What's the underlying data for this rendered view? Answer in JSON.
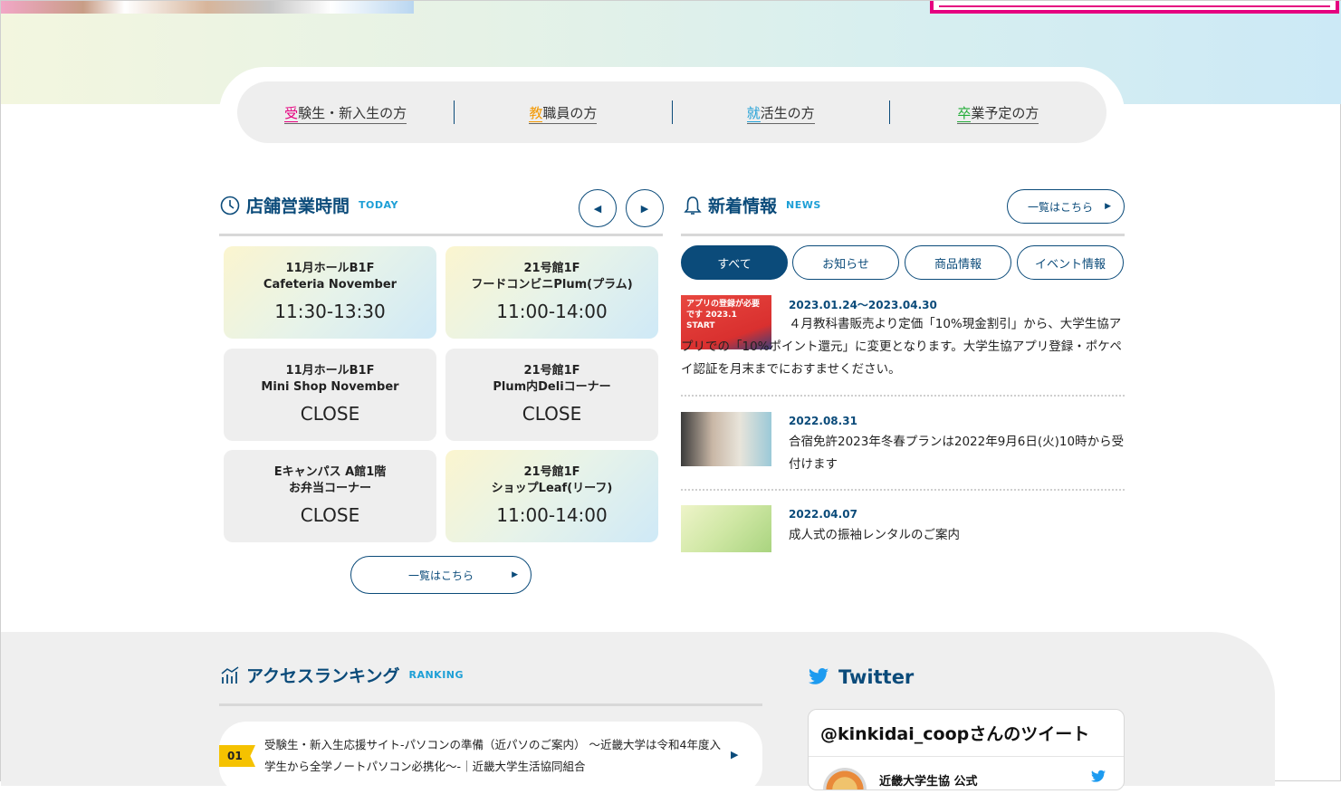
{
  "nav": {
    "items": [
      {
        "first": "受",
        "rest": "験生・新入生の方",
        "color": "#e5007f"
      },
      {
        "first": "教",
        "rest": "職員の方",
        "color": "#f39800"
      },
      {
        "first": "就",
        "rest": "活生の方",
        "color": "#1d9fd6"
      },
      {
        "first": "卒",
        "rest": "業予定の方",
        "color": "#22ac38"
      }
    ]
  },
  "hours": {
    "title": "店舗営業時間",
    "subtitle": "TODAY",
    "prev_label": "◀",
    "next_label": "▶",
    "stores": [
      {
        "line1": "11月ホールB1F",
        "line2": "Cafeteria November",
        "hours": "11:30-13:30"
      },
      {
        "line1": "21号館1F",
        "line2": "フードコンビニPlum(プラム)",
        "hours": "11:00-14:00"
      },
      {
        "line1": "11月ホールB1F",
        "line2": "Mini Shop November",
        "hours": "CLOSE"
      },
      {
        "line1": "21号館1F",
        "line2": "Plum内Deliコーナー",
        "hours": "CLOSE"
      },
      {
        "line1": "Eキャンパス A館1階",
        "line2": "お弁当コーナー",
        "hours": "CLOSE"
      },
      {
        "line1": "21号館1F",
        "line2": "ショップLeaf(リーフ)",
        "hours": "11:00-14:00"
      }
    ],
    "more_label": "一覧はこちら",
    "more_arrow": "▶"
  },
  "news": {
    "title": "新着情報",
    "subtitle": "NEWS",
    "more_label": "一覧はこちら",
    "more_arrow": "▶",
    "tabs": [
      "すべて",
      "お知らせ",
      "商品情報",
      "イベント情報"
    ],
    "items": [
      {
        "date": "2023.01.24〜2023.04.30",
        "text": "４月教科書販売より定価「10%現金割引」から、大学生協アプリでの「10%ポイント還元」に変更となります。大学生協アプリ登録・ポケペイ認証を月末までにおすませください。",
        "thumb_text": "アプリの登録が必要です 2023.1 START"
      },
      {
        "date": "2022.08.31",
        "text": "合宿免許2023年冬春プランは2022年9月6日(火)10時から受付けます"
      },
      {
        "date": "2022.04.07",
        "text": "成人式の振袖レンタルのご案内"
      }
    ]
  },
  "ranking": {
    "title": "アクセスランキング",
    "subtitle": "RANKING",
    "items": [
      {
        "rank": "01",
        "text": "受験生・新入生応援サイト-パソコンの準備（近パソのご案内） 〜近畿大学は令和4年度入学生から全学ノートパソコン必携化〜-｜近畿大学生活協同組合"
      }
    ]
  },
  "twitter": {
    "title": "Twitter",
    "header": "@kinkidai_coopさんのツイート",
    "account_name": "近畿大学生協 公式"
  }
}
